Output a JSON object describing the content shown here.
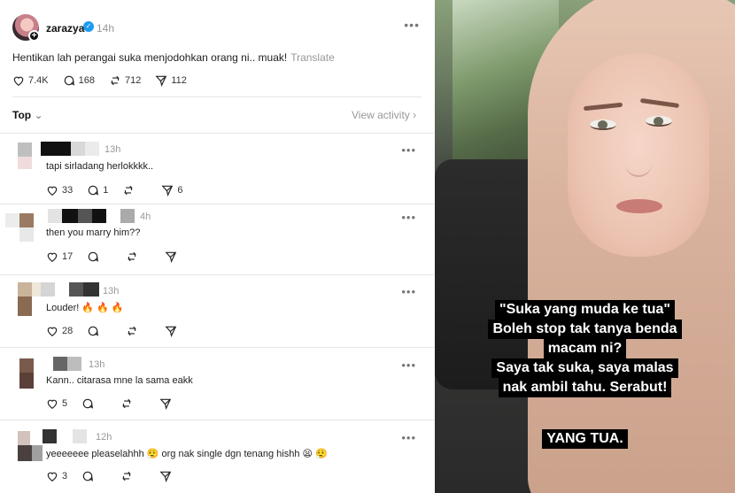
{
  "post": {
    "username": "zarazya",
    "time": "14h",
    "text": "Hentikan lah perangai suka menjodohkan orang ni.. muak!",
    "translate": "Translate",
    "likes": "7.4K",
    "replies": "168",
    "reposts": "712",
    "shares": "112"
  },
  "sort": {
    "label": "Top",
    "view_activity": "View activity"
  },
  "comments": [
    {
      "time": "13h",
      "text": "tapi sirladang herlokkkk..",
      "likes": "33",
      "replies": "1",
      "shares": "6"
    },
    {
      "time": "4h",
      "text": "then you marry him??",
      "likes": "17"
    },
    {
      "time": "13h",
      "text": "Louder! 🔥 🔥 🔥",
      "likes": "28"
    },
    {
      "time": "13h",
      "text": "Kann.. citarasa mne la sama eakk",
      "likes": "5"
    },
    {
      "time": "12h",
      "text": "yeeeeeee pleaselahhh 😮‍💨 org nak single dgn tenang hishh 😫 😮‍💨",
      "likes": "3"
    }
  ],
  "image_caption": {
    "lines": [
      "\"Suka yang muda ke tua\"",
      "Boleh stop tak tanya benda",
      "macam ni?",
      "Saya tak suka, saya malas",
      "nak ambil tahu. Serabut!"
    ],
    "answer": "YANG TUA."
  },
  "colors": {
    "verified": "#1d9bf0",
    "muted": "#999999",
    "caption_bg": "#000000"
  }
}
